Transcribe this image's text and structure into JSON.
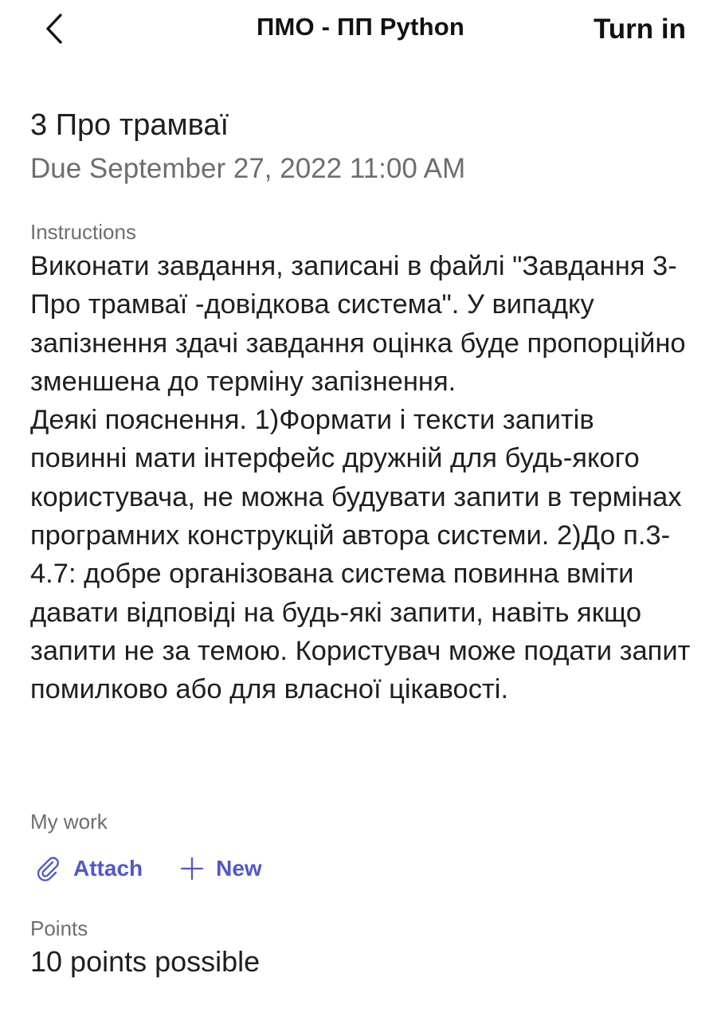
{
  "header": {
    "back_icon": "chevron-left-icon",
    "title": "ПМО - ПП Python",
    "turn_in_label": "Turn in"
  },
  "assignment": {
    "title": "3 Про трамваї",
    "due": "Due September 27, 2022 11:00 AM"
  },
  "instructions": {
    "label": "Instructions",
    "paragraphs": [
      "Виконати завдання, записані в файлі \"Завдання 3-Про трамваї -довідкова система\". У випадку запізнення здачі завдання оцінка буде пропорційно зменшена до терміну запізнення.",
      "Деякі пояснення. 1)Формати і тексти запитів повинні мати інтерфейс дружній для будь-якого користувача, не можна будувати запити в термінах програмних конструкцій автора системи. 2)До п.3-4.7: добре організована система повинна вміти давати відповіді на будь-які запити, навіть якщо запити не за темою. Користувач може подати запит помилково або для власної цікавості."
    ]
  },
  "my_work": {
    "label": "My work",
    "attach_label": "Attach",
    "attach_icon": "paperclip-icon",
    "new_label": "New",
    "new_icon": "plus-icon"
  },
  "points": {
    "label": "Points",
    "value": "10 points possible"
  },
  "colors": {
    "accent": "#5058c8",
    "text": "#1f1f1f",
    "secondary_text": "#6e6e6e"
  }
}
